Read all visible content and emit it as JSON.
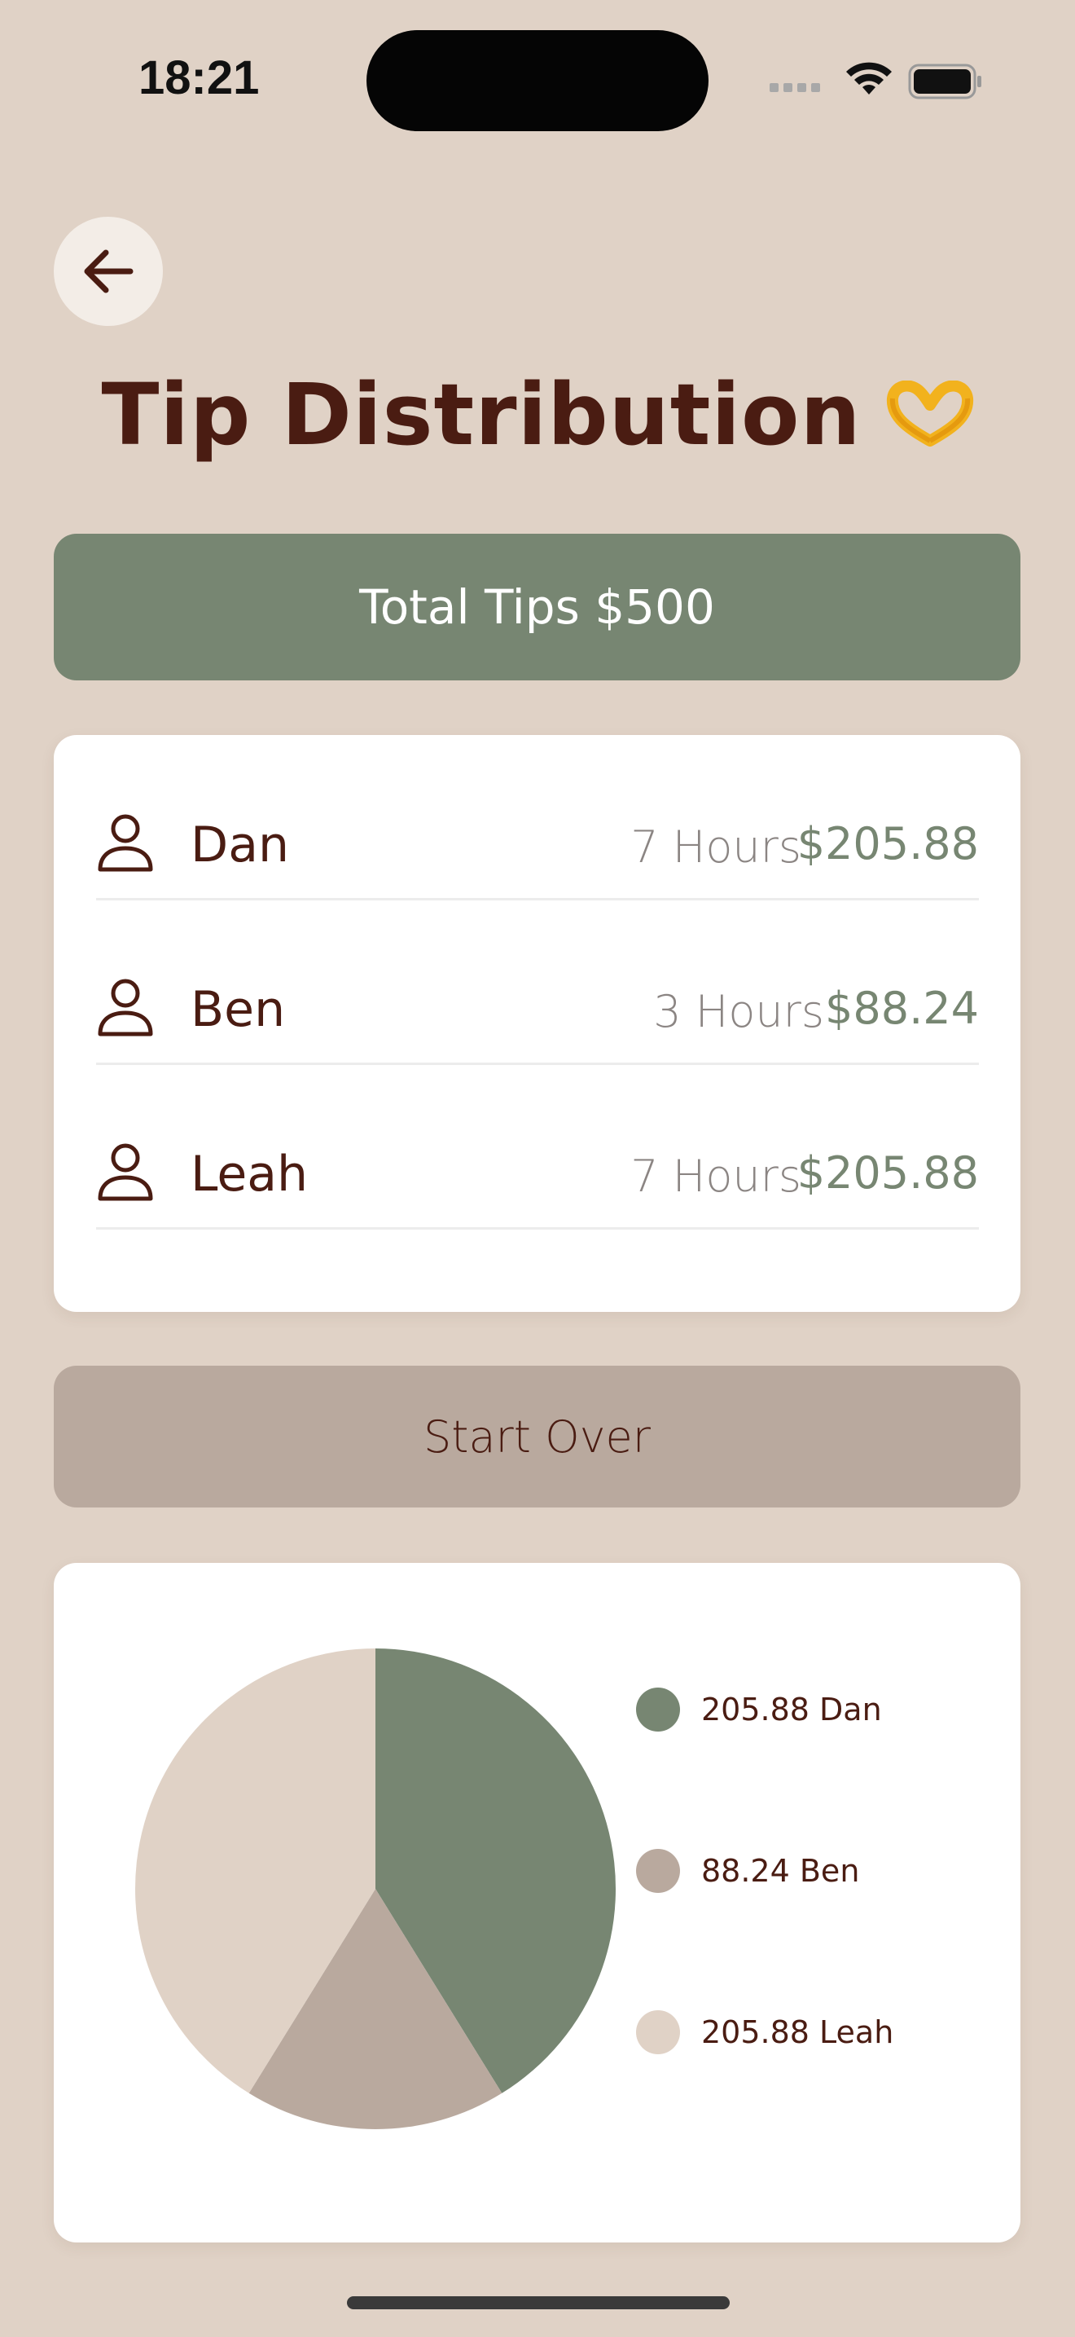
{
  "status_bar": {
    "time": "18:21"
  },
  "header": {
    "title": "Tip Distribution",
    "title_emoji": "🫶"
  },
  "total": {
    "label": "Total Tips $500"
  },
  "workers": [
    {
      "name": "Dan",
      "hours": "7 Hours",
      "amount": "$205.88"
    },
    {
      "name": "Ben",
      "hours": "3 Hours",
      "amount": "$88.24"
    },
    {
      "name": "Leah",
      "hours": "7 Hours",
      "amount": "$205.88"
    }
  ],
  "actions": {
    "start_over_label": "Start Over"
  },
  "colors": {
    "background": "#e0d2c6",
    "accent_green": "#778672",
    "taupe": "#b9a99e",
    "light_taupe": "#e0d2c6",
    "text_brown": "#4a1c12"
  },
  "chart_data": {
    "type": "pie",
    "slices": [
      {
        "label": "205.88 Dan",
        "name": "Dan",
        "value": 205.88,
        "color": "#778672"
      },
      {
        "label": "88.24 Ben",
        "name": "Ben",
        "value": 88.24,
        "color": "#b9a99e"
      },
      {
        "label": "205.88 Leah",
        "name": "Leah",
        "value": 205.88,
        "color": "#e0d2c6"
      }
    ],
    "title": "",
    "legend": "right"
  }
}
